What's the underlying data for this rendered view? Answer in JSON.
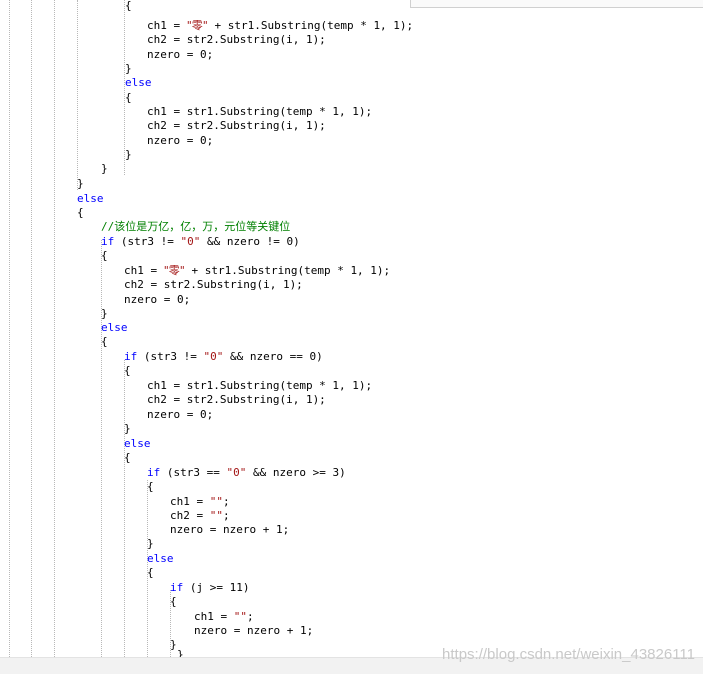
{
  "watermark": "https://blog.csdn.net/weixin_43826111",
  "lines": [
    {
      "segs": [
        {
          "t": "{"
        }
      ]
    },
    {
      "segs": [
        {
          "t": "ch1 = "
        },
        {
          "t": "\"零\"",
          "c": "cjk"
        },
        {
          "t": " + str1.Substring(temp * 1, 1);"
        }
      ]
    },
    {
      "segs": [
        {
          "t": "ch2 = str2.Substring(i, 1);"
        }
      ]
    },
    {
      "segs": [
        {
          "t": "nzero = 0;"
        }
      ]
    },
    {
      "segs": [
        {
          "t": "}"
        }
      ]
    },
    {
      "segs": [
        {
          "t": "else",
          "c": "kw"
        }
      ]
    },
    {
      "segs": [
        {
          "t": "{"
        }
      ]
    },
    {
      "segs": [
        {
          "t": "ch1 = str1.Substring(temp * 1, 1);"
        }
      ]
    },
    {
      "segs": [
        {
          "t": "ch2 = str2.Substring(i, 1);"
        }
      ]
    },
    {
      "segs": [
        {
          "t": "nzero = 0;"
        }
      ]
    },
    {
      "segs": [
        {
          "t": "}"
        }
      ]
    },
    {
      "segs": [
        {
          "t": "}"
        }
      ]
    },
    {
      "segs": [
        {
          "t": "}"
        }
      ]
    },
    {
      "segs": [
        {
          "t": "else",
          "c": "kw"
        }
      ]
    },
    {
      "segs": [
        {
          "t": "{"
        }
      ]
    },
    {
      "segs": [
        {
          "t": "//",
          "c": "cm"
        },
        {
          "t": "该位是万亿，亿，万，元位等关键位",
          "c": "cmcjk"
        }
      ]
    },
    {
      "segs": [
        {
          "t": "if",
          "c": "kw"
        },
        {
          "t": " (str3 != "
        },
        {
          "t": "\"0\"",
          "c": "str"
        },
        {
          "t": " && nzero != 0)"
        }
      ]
    },
    {
      "segs": [
        {
          "t": "{"
        }
      ]
    },
    {
      "segs": [
        {
          "t": "ch1 = "
        },
        {
          "t": "\"零\"",
          "c": "cjk"
        },
        {
          "t": " + str1.Substring(temp * 1, 1);"
        }
      ]
    },
    {
      "segs": [
        {
          "t": "ch2 = str2.Substring(i, 1);"
        }
      ]
    },
    {
      "segs": [
        {
          "t": "nzero = 0;"
        }
      ]
    },
    {
      "segs": [
        {
          "t": "}"
        }
      ]
    },
    {
      "segs": [
        {
          "t": "else",
          "c": "kw"
        }
      ]
    },
    {
      "segs": [
        {
          "t": "{"
        }
      ]
    },
    {
      "segs": [
        {
          "t": "if",
          "c": "kw"
        },
        {
          "t": " (str3 != "
        },
        {
          "t": "\"0\"",
          "c": "str"
        },
        {
          "t": " && nzero == 0)"
        }
      ]
    },
    {
      "segs": [
        {
          "t": "{"
        }
      ]
    },
    {
      "segs": [
        {
          "t": "ch1 = str1.Substring(temp * 1, 1);"
        }
      ]
    },
    {
      "segs": [
        {
          "t": "ch2 = str2.Substring(i, 1);"
        }
      ]
    },
    {
      "segs": [
        {
          "t": "nzero = 0;"
        }
      ]
    },
    {
      "segs": [
        {
          "t": "}"
        }
      ]
    },
    {
      "segs": [
        {
          "t": "else",
          "c": "kw"
        }
      ]
    },
    {
      "segs": [
        {
          "t": "{"
        }
      ]
    },
    {
      "segs": [
        {
          "t": "if",
          "c": "kw"
        },
        {
          "t": " (str3 == "
        },
        {
          "t": "\"0\"",
          "c": "str"
        },
        {
          "t": " && nzero >= 3)"
        }
      ]
    },
    {
      "segs": [
        {
          "t": "{"
        }
      ]
    },
    {
      "segs": [
        {
          "t": "ch1 = "
        },
        {
          "t": "\"\"",
          "c": "str"
        },
        {
          "t": ";"
        }
      ]
    },
    {
      "segs": [
        {
          "t": "ch2 = "
        },
        {
          "t": "\"\"",
          "c": "str"
        },
        {
          "t": ";"
        }
      ]
    },
    {
      "segs": [
        {
          "t": "nzero = nzero + 1;"
        }
      ]
    },
    {
      "segs": [
        {
          "t": "}"
        }
      ]
    },
    {
      "segs": [
        {
          "t": "else",
          "c": "kw"
        }
      ]
    },
    {
      "segs": [
        {
          "t": "{"
        }
      ]
    },
    {
      "segs": [
        {
          "t": "if",
          "c": "kw"
        },
        {
          "t": " (j >= 11)"
        }
      ]
    },
    {
      "segs": [
        {
          "t": "{"
        }
      ]
    },
    {
      "segs": [
        {
          "t": "ch1 = "
        },
        {
          "t": "\"\"",
          "c": "str"
        },
        {
          "t": ";"
        }
      ]
    },
    {
      "segs": [
        {
          "t": "nzero = nzero + 1;"
        }
      ]
    },
    {
      "segs": [
        {
          "t": "}"
        }
      ]
    },
    {
      "segs": [
        {
          "t": "}"
        }
      ]
    }
  ]
}
